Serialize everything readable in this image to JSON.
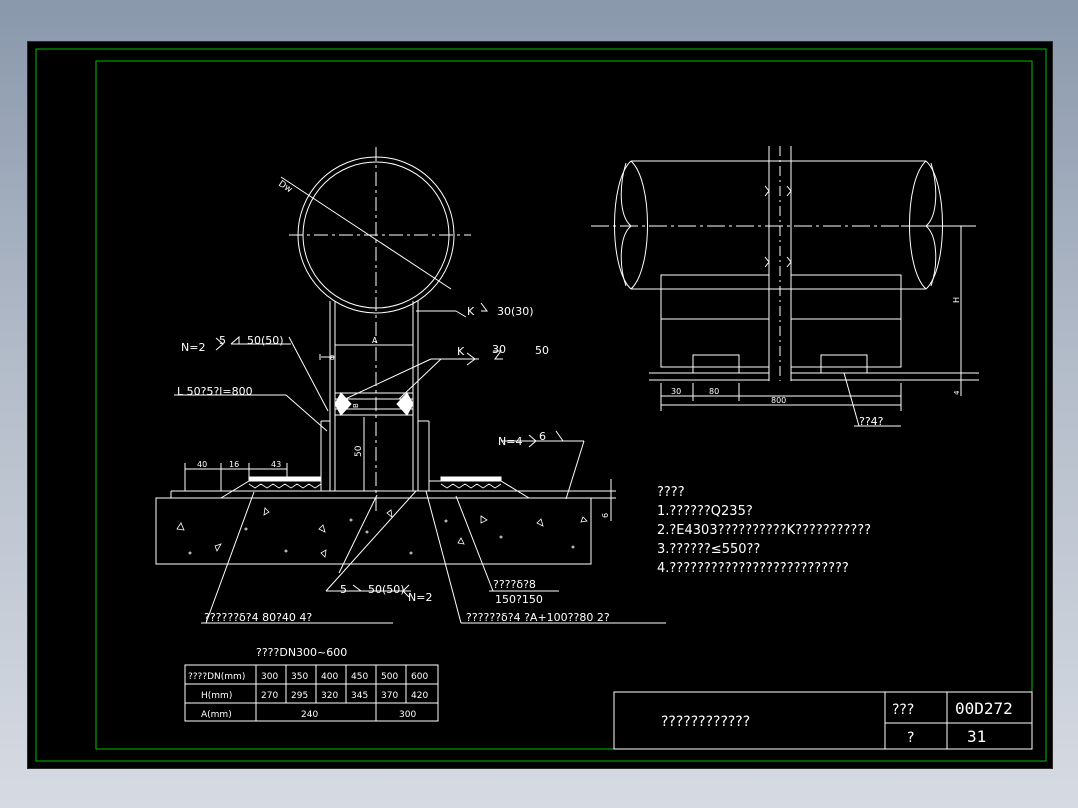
{
  "colors": {
    "background": "#000000",
    "lines": "#ffffff",
    "frame": "#00c000"
  },
  "drawing": {
    "left_view": {
      "diameter_label": "Dw",
      "weld_k_30": "K",
      "weld_k_30_value": "30(30)",
      "weld_n2_top": "N=2",
      "weld_n2_top_size": "5",
      "weld_n2_top_value": "50(50)",
      "angle_steel": "L 50?5?l=800",
      "dim_8": "8",
      "dim_a": "A",
      "dim_b": "B",
      "dim_50_vertical": "50",
      "k_right": "K",
      "k_right_value": "30",
      "k_right_value2": "50",
      "n4": "N=4",
      "n4_value": "6",
      "dim_40": "40",
      "dim_16": "16",
      "dim_43": "43",
      "dim_6": "6",
      "weld_bottom_size": "5",
      "weld_bottom_value": "50(50)",
      "weld_bottom_n": "N=2",
      "plate_label_1": "????δ?8",
      "plate_label_2": "150?150",
      "bottom_label_left": "??????δ?4  80?40  4?",
      "bottom_label_right": "??????δ?4  ?A+100??80  2?"
    },
    "right_view": {
      "dim_h": "H",
      "dim_4": "4",
      "dim_30": "30",
      "dim_80": "80",
      "dim_800": "800",
      "part_label": "??4?"
    },
    "notes": {
      "title": "????",
      "items": [
        "1.??????Q235?",
        "2.?E4303??????????K???????????",
        "3.??????≤550??",
        "4.??????????????????????????"
      ]
    },
    "table": {
      "title": "????DN300~600",
      "rows": [
        [
          "????DN(mm)",
          "300",
          "350",
          "400",
          "450",
          "500",
          "600"
        ],
        [
          "H(mm)",
          "270",
          "295",
          "320",
          "345",
          "370",
          "420"
        ]
      ],
      "a_row": {
        "label": "A(mm)",
        "value1": "240",
        "value2": "300"
      }
    },
    "title_block": {
      "drawing_name": "????????????",
      "label_1": "???",
      "value_1": "00D272",
      "label_2": "?",
      "value_2": "31"
    }
  }
}
